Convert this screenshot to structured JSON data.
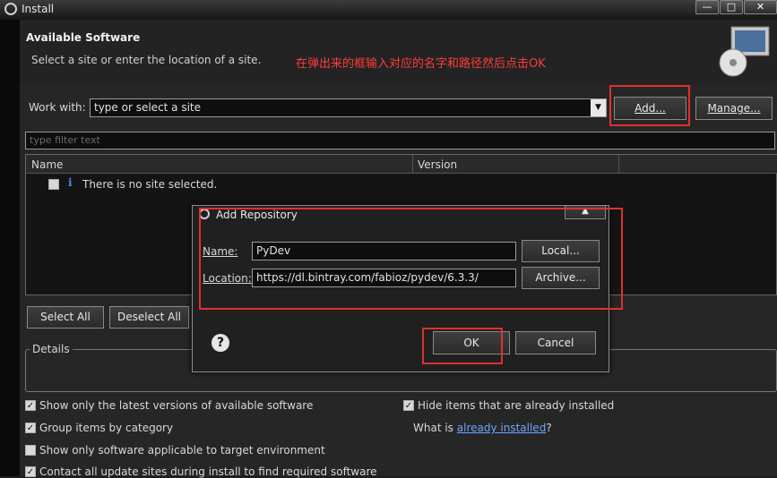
{
  "window": {
    "title": "Install",
    "minimize": "—",
    "maximize": "□",
    "close": "✕"
  },
  "header": {
    "title": "Available Software",
    "subtitle": "Select a site or enter the location of a site.",
    "annotation": "在弹出来的框输入对应的名字和路径然后点击OK"
  },
  "work_with": {
    "label": "Work with:",
    "value": "type or select a site",
    "add_label": "Add...",
    "manage_label": "Manage..."
  },
  "filter": {
    "placeholder": "type filter text"
  },
  "table": {
    "columns": [
      "Name",
      "Version"
    ],
    "empty_message": "There is no site selected."
  },
  "selection": {
    "select_all": "Select All",
    "deselect_all": "Deselect All"
  },
  "details": {
    "label": "Details"
  },
  "options": {
    "latest_versions": "Show only the latest versions of available software",
    "group_by_category": "Group items by category",
    "applicable_only": "Show only software applicable to target environment",
    "contact_all": "Contact all update sites during install to find required software",
    "hide_installed": "Hide items that are already installed",
    "what_is": "What is",
    "already_installed_link": "already installed",
    "question_mark": "?"
  },
  "dialog": {
    "title": "Add Repository",
    "name_label": "Name:",
    "name_value": "PyDev",
    "location_label": "Location:",
    "location_value": "https://dl.bintray.com/fabioz/pydev/6.3.3/",
    "local_label": "Local...",
    "archive_label": "Archive...",
    "ok_label": "OK",
    "cancel_label": "Cancel",
    "help": "?"
  },
  "colors": {
    "annotation": "#ff3b3b",
    "highlight": "#e03030",
    "link": "#6aa6ff"
  }
}
